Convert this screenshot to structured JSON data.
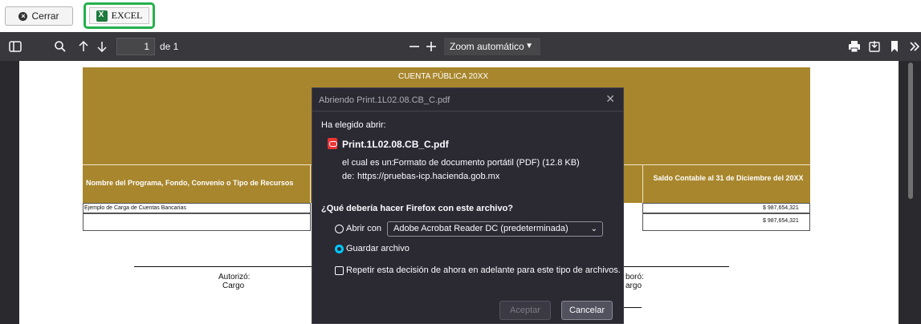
{
  "topbar": {
    "cerrar_label": "Cerrar",
    "excel_label": "EXCEL",
    "excel_highlight_color": "#25b04c"
  },
  "pdf_toolbar": {
    "page_current": "1",
    "page_total_label": "de 1",
    "zoom_value": "Zoom automático"
  },
  "document": {
    "header_title": "CUENTA PÚBLICA 20XX",
    "col_program": "Nombre del Programa, Fondo, Convenio o Tipo de Recursos",
    "col_saldo": "Saldo Contable al 31 de Diciembre del 20XX",
    "row1_name": "Ejemplo de Carga de Cuentas Bancarias",
    "row1_value": "$ 987,654,321",
    "row2_value": "$ 987,654,321",
    "sign_left_label": "Autorizó:",
    "sign_left_role": "Cargo",
    "sign_right_label": "boró:",
    "sign_right_role": "argo",
    "header_color": "#a8862d"
  },
  "dialog": {
    "title": "Abriendo Print.1L02.08.CB_C.pdf",
    "chosen_label": "Ha elegido abrir:",
    "filename": "Print.1L02.08.CB_C.pdf",
    "type_prefix": "el cual es un:",
    "type_value": "Formato de documento portátil (PDF) (12.8 KB)",
    "from_prefix": "de:",
    "from_value": "https://pruebas-icp.hacienda.gob.mx",
    "question": "¿Qué debería hacer Firefox con este archivo?",
    "open_with_label": "Abrir con",
    "open_with_app": "Adobe Acrobat Reader DC (predeterminada)",
    "save_label": "Guardar archivo",
    "remember_label": "Repetir esta decisión de ahora en adelante para este tipo de archivos.",
    "accept_label": "Aceptar",
    "cancel_label": "Cancelar",
    "selected_option": "Guardar archivo"
  }
}
